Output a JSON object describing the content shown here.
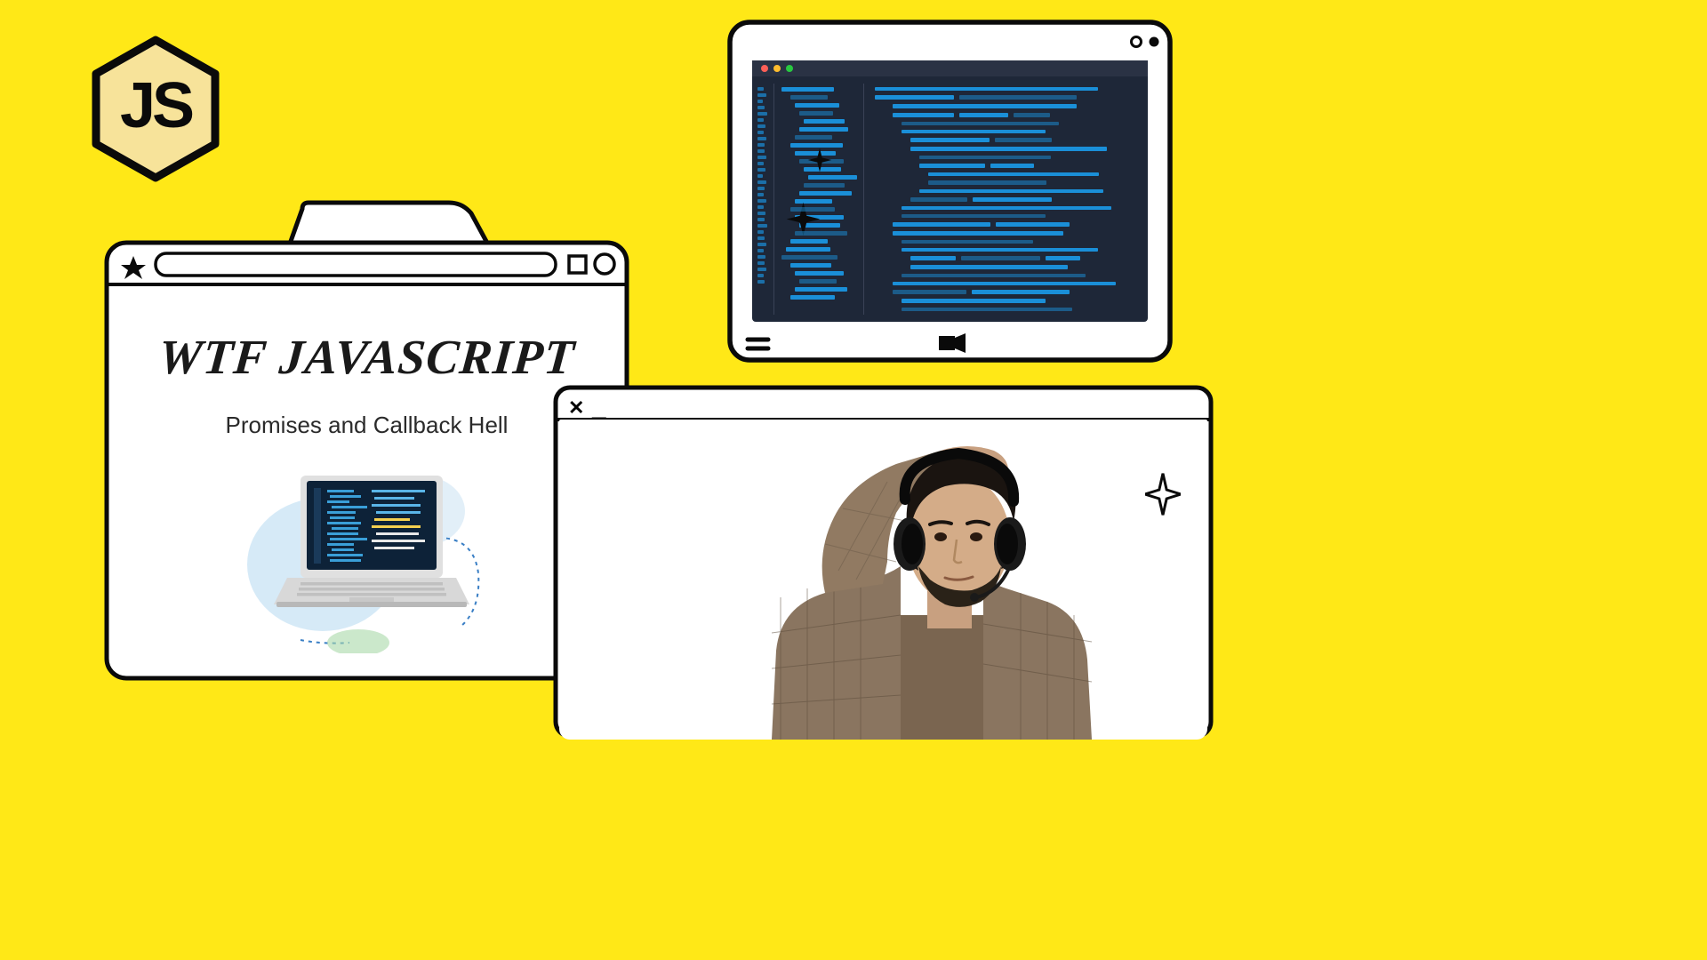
{
  "logo": {
    "text": "JS"
  },
  "main_window": {
    "title": "WTF JAVASCRIPT",
    "subtitle": "Promises and Callback Hell"
  },
  "description": "YouTube/tutorial thumbnail graphic with JavaScript logo, sketched browser windows, a code editor mockup, and a photo of a confused presenter wearing headphones."
}
